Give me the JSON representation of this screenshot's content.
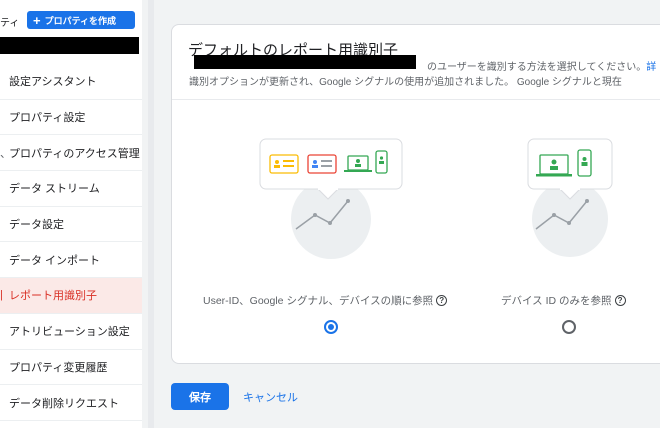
{
  "sidebar": {
    "property_label": "ティ",
    "create_button": "プロパティを作成",
    "items": [
      {
        "label": "設定アシスタント",
        "lead": ""
      },
      {
        "label": "プロパティ設定",
        "lead": ""
      },
      {
        "label": "プロパティのアクセス管理",
        "lead": "、"
      },
      {
        "label": "データ ストリーム",
        "lead": ""
      },
      {
        "label": "データ設定",
        "lead": ""
      },
      {
        "label": "データ インポート",
        "lead": ""
      },
      {
        "label": "レポート用識別子",
        "lead": "|"
      },
      {
        "label": "アトリビューション設定",
        "lead": ""
      },
      {
        "label": "プロパティ変更履歴",
        "lead": ""
      },
      {
        "label": "データ削除リクエスト",
        "lead": ""
      }
    ],
    "active_index": 6
  },
  "card": {
    "title": "デフォルトのレポート用識別子",
    "desc_line1": "のユーザーを識別する方法を選択してください。",
    "desc_line1_link": "詳",
    "desc_line2": "識別オプションが更新され、Google シグナルの使用が追加されました。 Google シグナルと現在"
  },
  "options": [
    {
      "label": "User-ID、Google シグナル、デバイスの順に参照",
      "selected": true
    },
    {
      "label": "デバイス ID のみを参照",
      "selected": false
    }
  ],
  "help_glyph": "?",
  "actions": {
    "save": "保存",
    "cancel": "キャンセル"
  },
  "colors": {
    "accent": "#1a73e8",
    "active_red": "#d93025"
  }
}
